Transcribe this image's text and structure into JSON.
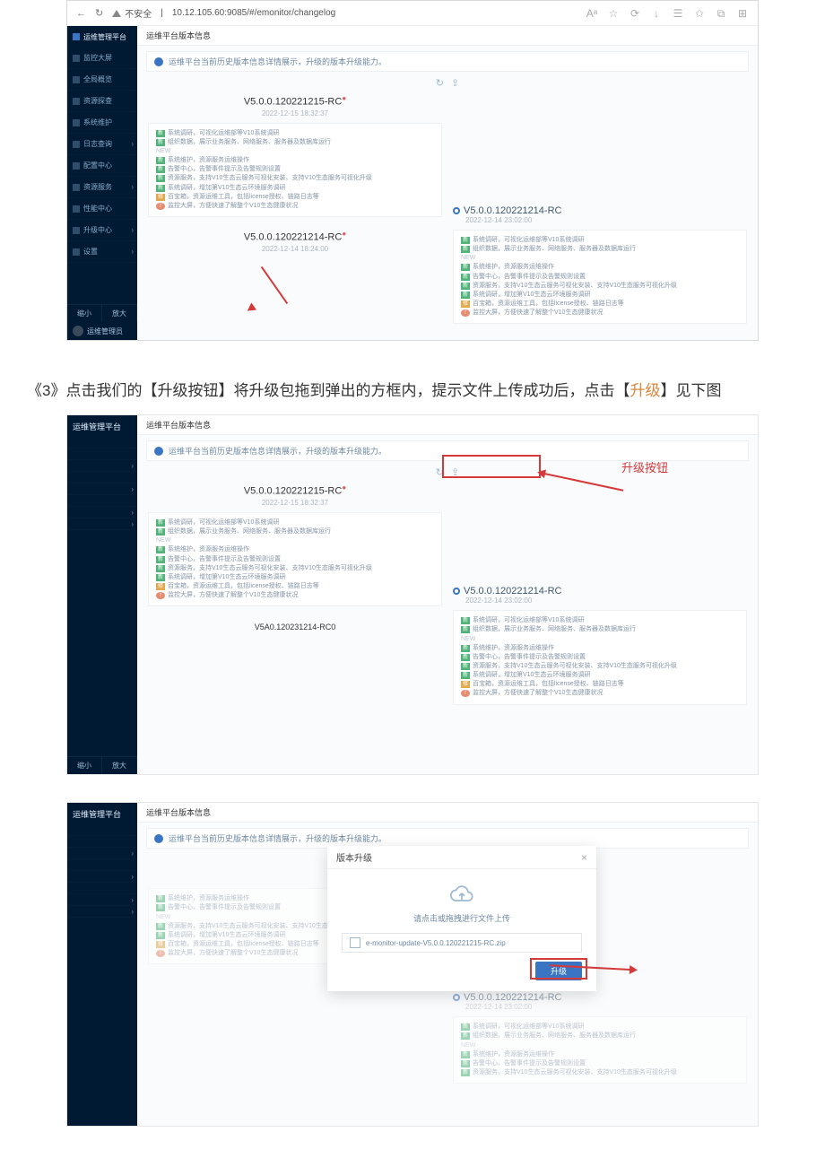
{
  "browser": {
    "insecure_label": "不安全",
    "url": "10.12.105.60:9085/#/emonitor/changelog"
  },
  "sidebar": {
    "product": "运维管理平台",
    "items": [
      "监控大屏",
      "全局概览",
      "资源探查",
      "系统维护",
      "日志查询",
      "配置中心",
      "资源服务",
      "性能中心",
      "升级中心",
      "设置"
    ],
    "zoom_out": "缩小",
    "zoom_in": "放大",
    "user": "运维管理员"
  },
  "main": {
    "title": "运维平台版本信息",
    "tip": "运维平台当前历史版本信息详情展示，升级的版本升级能力。"
  },
  "versions": {
    "v1_title": "V5.0.0.120221215-RC",
    "v1_date": "2022-12-15 18:32:37",
    "v2_title": "V5.0.0.120221214-RC",
    "v2_date_a": "2022-12-14 23:02:00",
    "v2_date_b": "2022-12-14 18:24:00",
    "v3_bottom": "V5A0.120231214-RC0",
    "lines": {
      "l1": "系统调研，可视化运维部等V10系统调研",
      "l2": "组织数据，展示业务服务、网络服务、服务器及数据库运行",
      "l3": "系统维护，资源服务运维操作",
      "l4": "告警中心，告警事件提示及告警规则设置",
      "l5": "资源服务，支持V10生态云服务可视化安装、支持V10生态服务可视化升级",
      "l6": "系统调研，增加第V10生态云环境服务调研",
      "l7": "百宝箱，资源运维工具，包括license授权、链路日志等",
      "l8": "监控大屏，方便快速了解整个V10生态健康状况",
      "note": "NEW"
    }
  },
  "tags": {
    "new": "新",
    "fix": "修",
    "warn": "!"
  },
  "instruction": {
    "num": "《3》",
    "text_a": "点击我们的【升级按钮】将升级包拖到弹出的方框内，提示文件上传成功后，点击【",
    "orange": "升级",
    "text_b": "】见下图"
  },
  "annotation": {
    "upgrade_btn_label": "升级按钮"
  },
  "modal": {
    "title": "版本升级",
    "hint": "请点击或拖拽进行文件上传",
    "file": "e-monitor-update-V5.0.0.120221215-RC.zip",
    "upgrade": "升级"
  }
}
